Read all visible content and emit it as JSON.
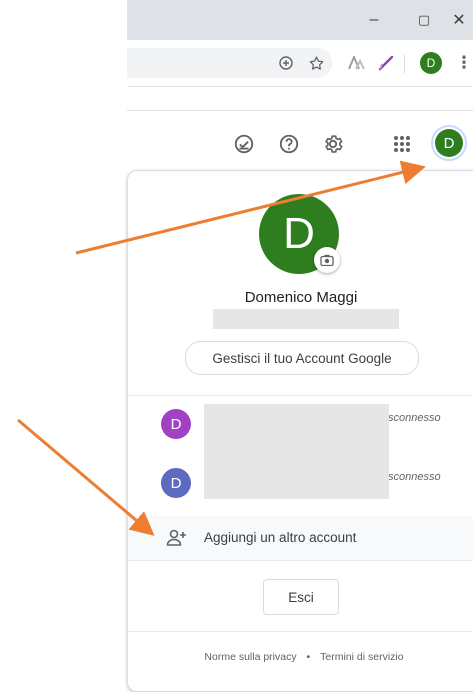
{
  "browser": {
    "window_controls": {
      "minimize": "–",
      "maximize": "▢",
      "close": "✕"
    },
    "profile_initial": "D"
  },
  "app_header": {
    "avatar_initial": "D"
  },
  "account_panel": {
    "avatar_initial": "D",
    "user_name": "Domenico Maggi",
    "manage_button_label": "Gestisci il tuo Account Google",
    "other_accounts": [
      {
        "initial": "D",
        "status": "sconnesso",
        "color": "#a142c5"
      },
      {
        "initial": "D",
        "status": "sconnesso",
        "color": "#5c6bc0"
      }
    ],
    "add_account_label": "Aggiungi un altro account",
    "logout_label": "Esci",
    "footer": {
      "privacy_link": "Norme sulla privacy",
      "separator": "•",
      "terms_link": "Termini di servizio"
    }
  },
  "colors": {
    "avatar_green": "#2e7d1e",
    "annotation_arrow": "#ee7d31"
  }
}
